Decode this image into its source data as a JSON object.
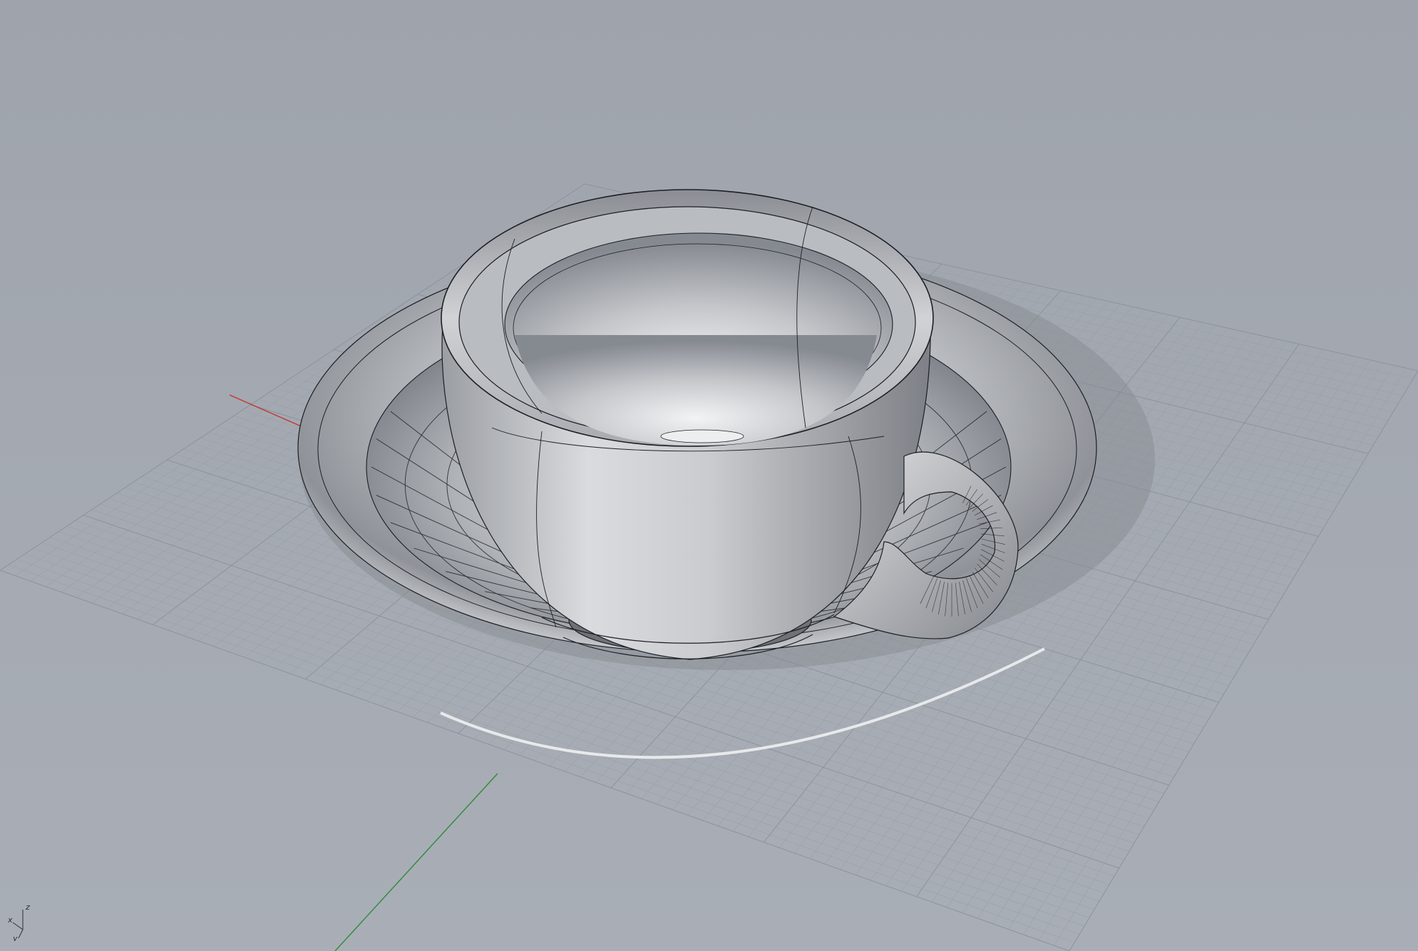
{
  "viewport": {
    "background_color": "#a4a9b1",
    "grid_minor_color": "#97a0aa",
    "grid_major_color": "#8a93a0",
    "x_axis_color": "#c0392b",
    "y_axis_color": "#2e8b3a",
    "display_mode": "shaded-wireframe"
  },
  "axis_widget": {
    "x_label": "x",
    "y_label": "y",
    "z_label": "z"
  },
  "model": {
    "objects": [
      "cup",
      "saucer"
    ],
    "surface_color": "#bfc2c6",
    "edge_color": "#1c1f24"
  }
}
